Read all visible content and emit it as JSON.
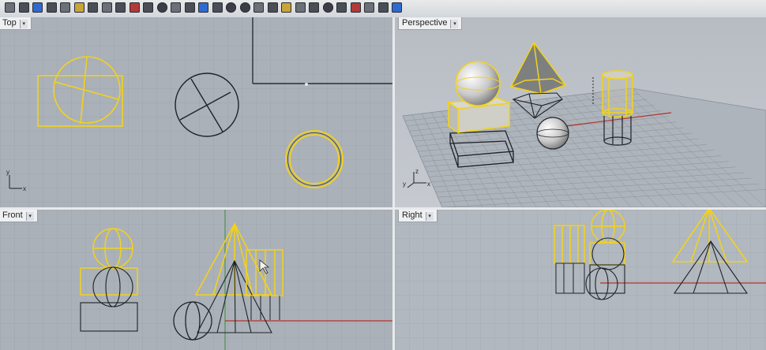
{
  "toolbar": {
    "icons": [
      "new-icon",
      "open-icon",
      "save-icon",
      "print-icon",
      "cut-icon",
      "copy-icon",
      "paste-icon",
      "undo-icon",
      "redo-icon",
      "pan-icon",
      "rotate-icon",
      "zoom-icon",
      "zoom-window-icon",
      "zoom-extents-icon",
      "zoom-selected-icon",
      "viewport-icon",
      "layer-icon",
      "properties-icon",
      "wireframe-icon",
      "shaded-icon",
      "rendered-icon",
      "point-icon",
      "curve-icon",
      "surface-icon",
      "solid-icon",
      "mesh-icon",
      "render-icon",
      "light-icon",
      "options-icon"
    ]
  },
  "viewports": {
    "top": {
      "label": "Top",
      "axis_x": "x",
      "axis_y": "y"
    },
    "perspective": {
      "label": "Perspective",
      "axis_x": "x",
      "axis_y": "y",
      "axis_z": "z"
    },
    "front": {
      "label": "Front"
    },
    "right": {
      "label": "Right"
    }
  },
  "colors": {
    "selection": "#f2d21c",
    "wireframe": "#1f2328",
    "grid_bg": "#a9afb6",
    "grid_line": "#8f969e",
    "x_axis": "#b3312a",
    "y_axis": "#3a8a3a"
  }
}
